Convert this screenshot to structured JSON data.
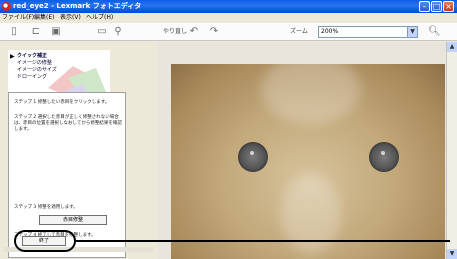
{
  "window": {
    "title": "red_eye2 - Lexmark フォトエディタ"
  },
  "menubar": {
    "items": [
      "ファイル(F)",
      "編集(E)",
      "表示(V)",
      "ヘルプ(H)"
    ]
  },
  "toolbar": {
    "undo_label": "やり直し",
    "zoom_label": "ズーム",
    "zoom_value": "200%"
  },
  "nav": {
    "items": [
      {
        "label": "クイック補正"
      },
      {
        "label": "イメージの修整"
      },
      {
        "label": "イメージのサイズ"
      },
      {
        "label": "ドローイング"
      }
    ]
  },
  "instructions": {
    "step1": "ステップ 1   修整したい赤目をクリックします。",
    "step2": "ステップ 2   選択した赤目が正しく修整されない場合は、赤目の位置を選択しなおしてから修整結果を確認します。",
    "step3": "ステップ 3   修整を適用します。",
    "correct_button": "赤目修整",
    "step4": "ステップ 4   終了して赤目を修整します。",
    "finish_button": "終了"
  },
  "colors": {
    "titlebar": "#0a5fe3",
    "panel_bg": "#ece9d8",
    "eye_corrected": "#555555"
  }
}
